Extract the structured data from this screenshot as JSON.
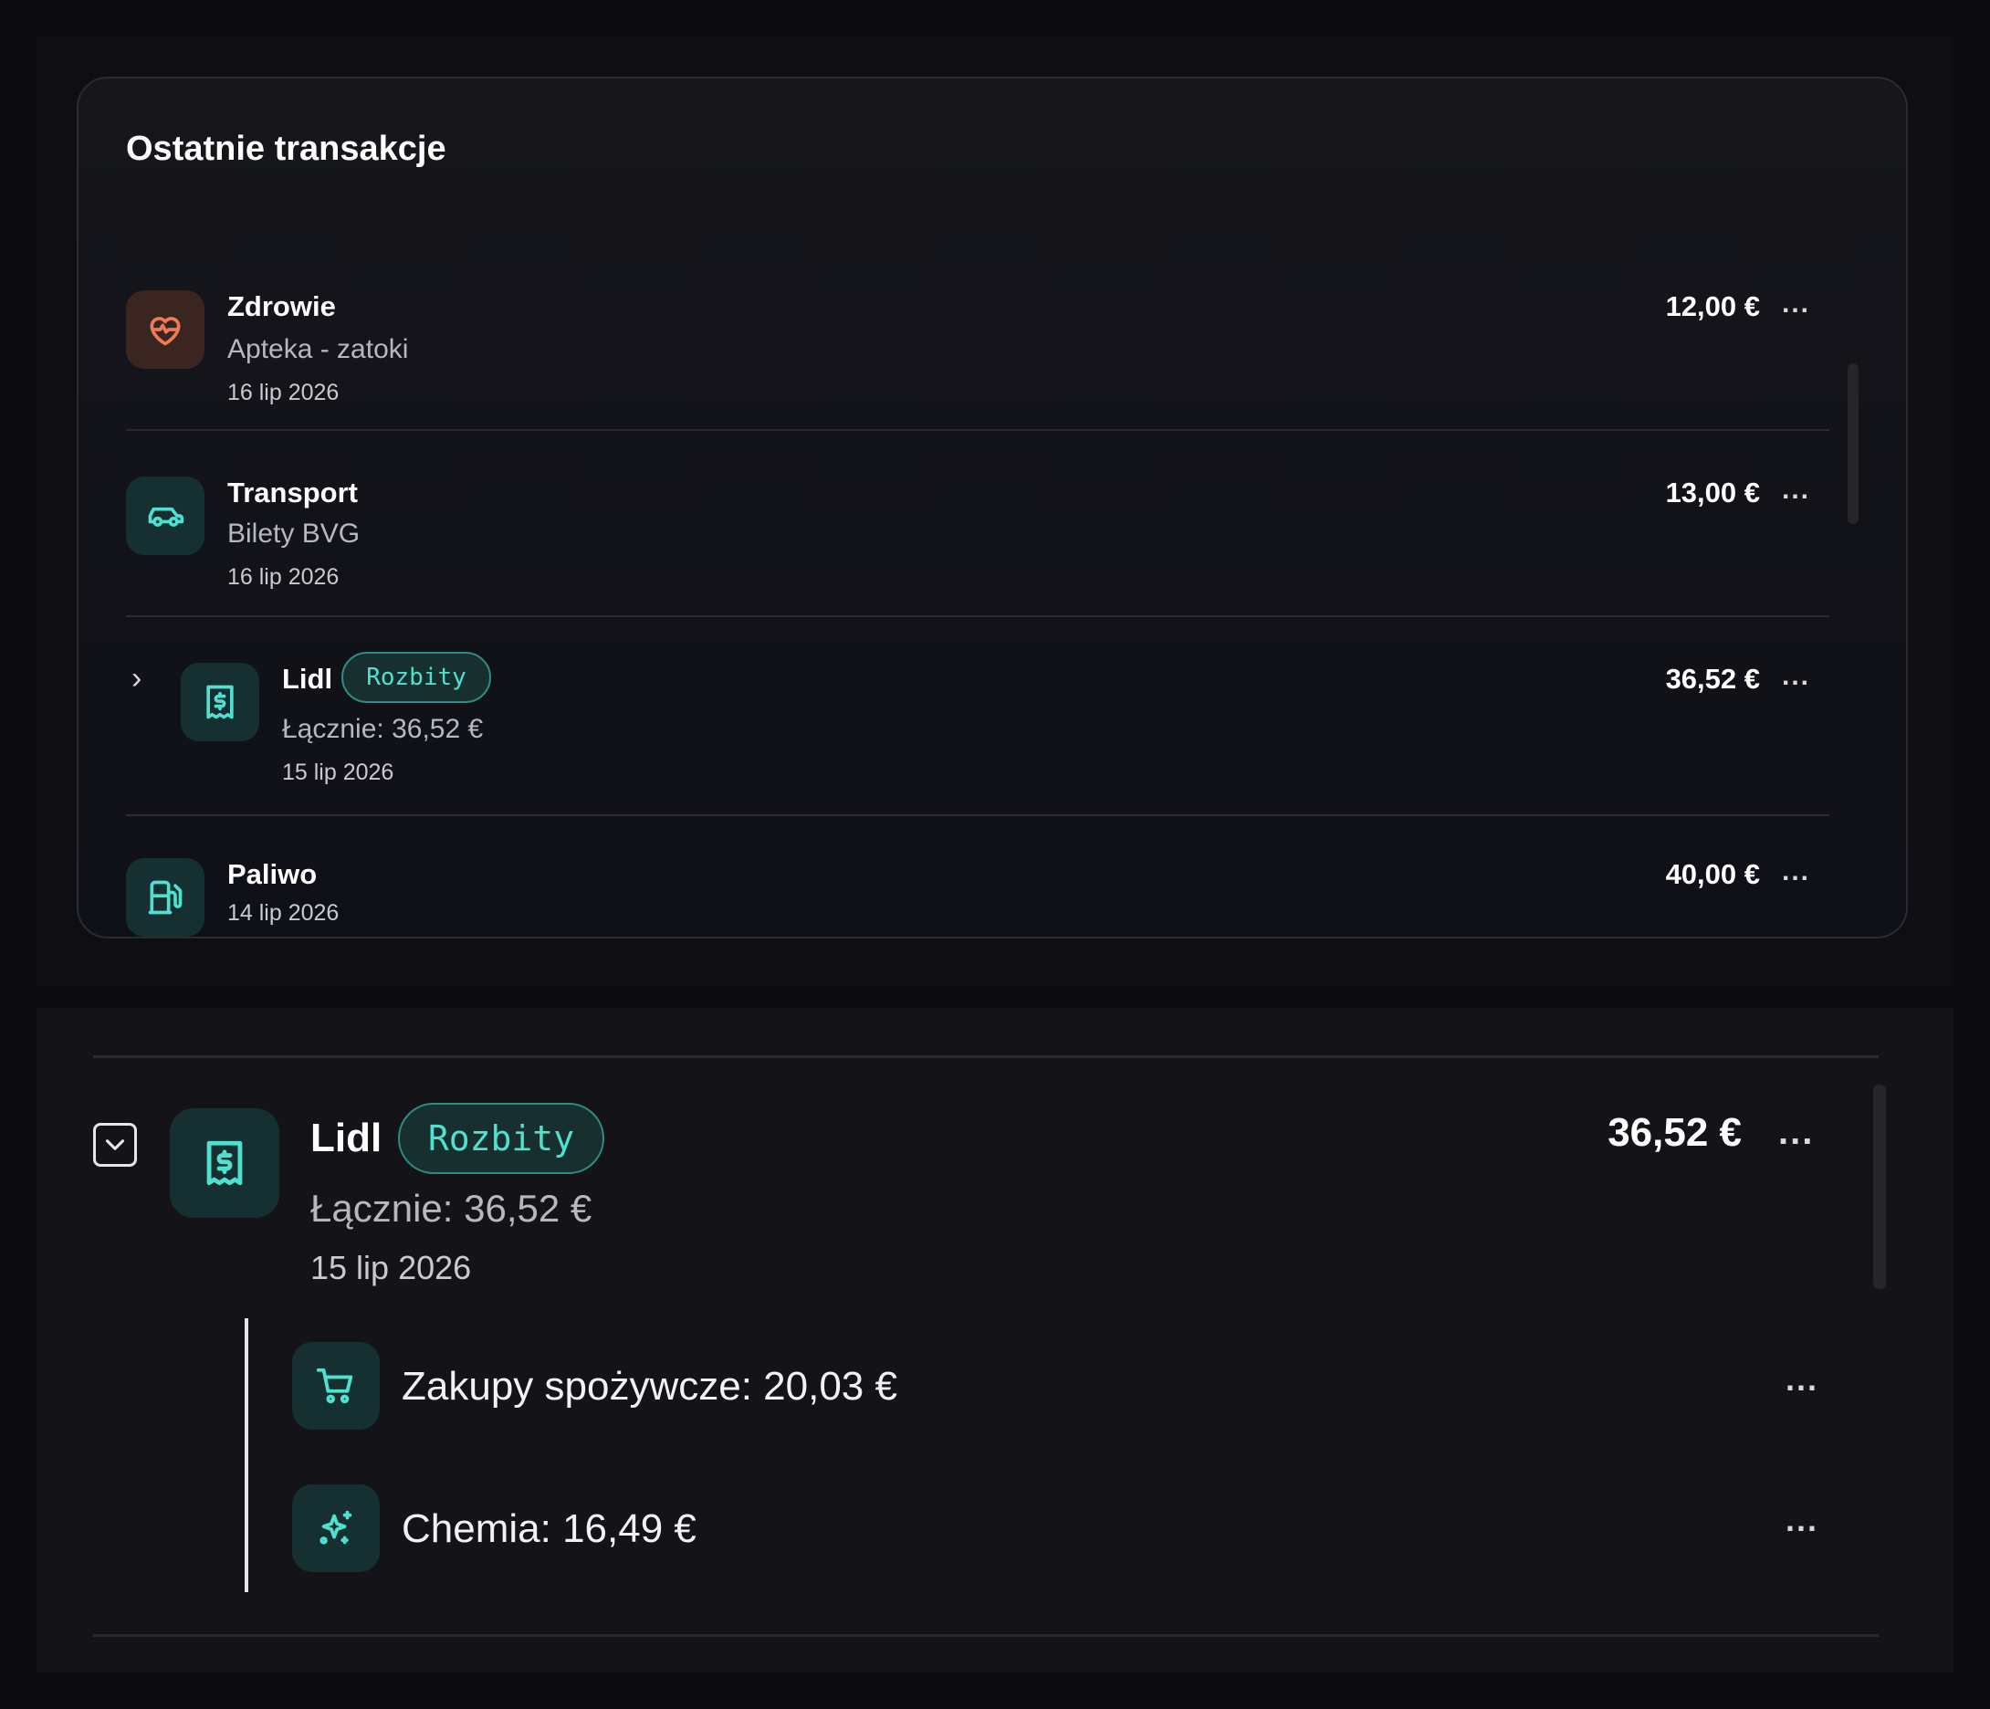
{
  "card": {
    "title": "Ostatnie transakcje",
    "transactions": [
      {
        "name": "Zdrowie",
        "subtitle": "Apteka - zatoki",
        "date": "16 lip 2026",
        "amount": "12,00 €",
        "more": "...",
        "icon": "heart-pulse-icon"
      },
      {
        "name": "Transport",
        "subtitle": "Bilety BVG",
        "date": "16 lip 2026",
        "amount": "13,00 €",
        "more": "...",
        "icon": "car-icon"
      },
      {
        "name": "Lidl",
        "badge": "Rozbity",
        "subtitle": "Łącznie: 36,52 €",
        "date": "15 lip 2026",
        "amount": "36,52 €",
        "more": "...",
        "icon": "receipt-dollar-icon"
      },
      {
        "name": "Paliwo",
        "date": "14 lip 2026",
        "amount": "40,00 €",
        "more": "...",
        "icon": "fuel-pump-icon"
      }
    ]
  },
  "expanded": {
    "name": "Lidl",
    "badge": "Rozbity",
    "subtitle": "Łącznie: 36,52 €",
    "date": "15 lip 2026",
    "amount": "36,52 €",
    "more": "...",
    "icon": "receipt-dollar-icon",
    "splits": [
      {
        "label": "Zakupy spożywcze: 20,03 €",
        "more": "...",
        "icon": "shopping-cart-icon"
      },
      {
        "label": "Chemia: 16,49 €",
        "more": "...",
        "icon": "sparkles-icon"
      }
    ]
  },
  "colors": {
    "accent_teal": "#4fe0cf",
    "health_orange": "#f07a55",
    "background": "#0b0b0f"
  }
}
